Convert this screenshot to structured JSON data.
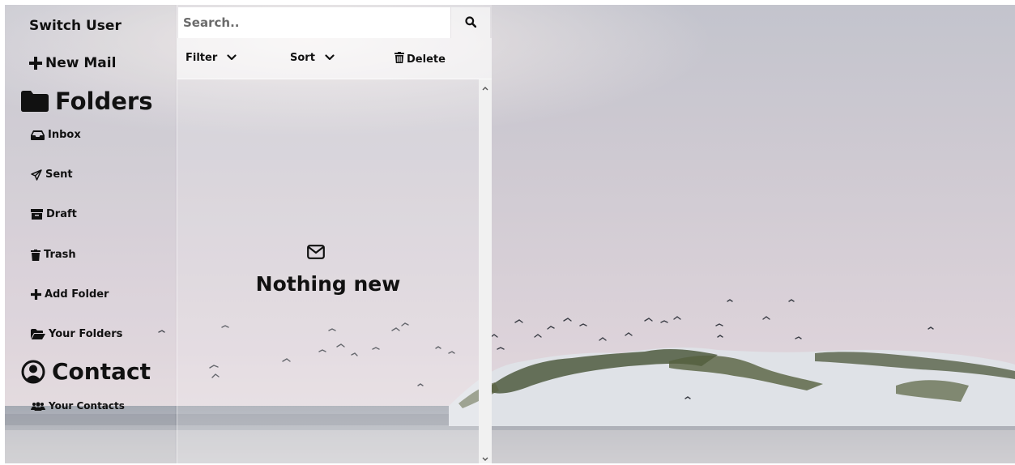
{
  "sidebar": {
    "switch_user": "Switch User",
    "new_mail": "New Mail",
    "folders_heading": "Folders",
    "items": [
      {
        "label": "Inbox",
        "icon": "inbox-icon"
      },
      {
        "label": "Sent",
        "icon": "paper-plane-icon"
      },
      {
        "label": "Draft",
        "icon": "archive-icon"
      },
      {
        "label": "Trash",
        "icon": "trash-icon"
      },
      {
        "label": "Add Folder",
        "icon": "plus-icon"
      },
      {
        "label": "Your Folders",
        "icon": "folder-open-icon"
      }
    ],
    "contact_heading": "Contact",
    "your_contacts": "Your Contacts"
  },
  "search": {
    "placeholder": "Search.."
  },
  "toolbar": {
    "filter_label": "Filter",
    "sort_label": "Sort",
    "delete_label": "Delete"
  },
  "mail_list": {
    "empty_message": "Nothing new",
    "empty_icon": "envelope-icon"
  }
}
